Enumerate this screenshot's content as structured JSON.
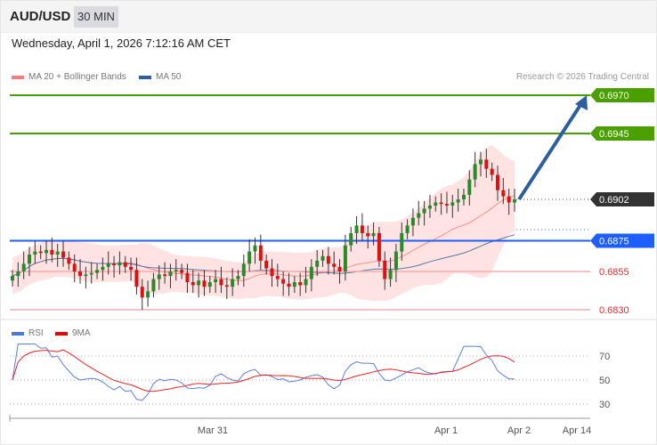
{
  "header": {
    "symbol": "AUD/USD",
    "timeframe": "30 MIN"
  },
  "timestamp": "Wednesday, April 1, 2026 7:12:16 AM CET",
  "legend": {
    "ma20": "MA 20 + Bollinger Bands",
    "ma50": "MA 50",
    "ma20_color": "#ff7b7b",
    "ma50_color": "#2d5fa0"
  },
  "copyright": "Research © 2026 Trading Central",
  "levels": [
    {
      "label": "0.6970",
      "value": 0.697,
      "type": "target",
      "color": "#4aa000"
    },
    {
      "label": "0.6945",
      "value": 0.6945,
      "type": "target",
      "color": "#4aa000"
    },
    {
      "label": "0.6902",
      "value": 0.6902,
      "type": "last",
      "color": "#333333"
    },
    {
      "label": "0.6875",
      "value": 0.6875,
      "type": "pivot",
      "color": "#1e5eff"
    },
    {
      "label": "0.6855",
      "value": 0.6855,
      "type": "support",
      "color": "#ff2020"
    },
    {
      "label": "0.6830",
      "value": 0.683,
      "type": "support",
      "color": "#ff2020"
    }
  ],
  "rsi_legend": {
    "rsi": "RSI",
    "ma": "9MA"
  },
  "rsi_ticks": [
    "70",
    "50",
    "30"
  ],
  "x_labels": [
    "Mar 31",
    "Apr 1",
    "Apr 2",
    "Apr 14"
  ],
  "chart_data": {
    "type": "candlestick",
    "ylim": [
      0.6822,
      0.6985
    ],
    "closes": [
      0.6852,
      0.6855,
      0.686,
      0.6866,
      0.6868,
      0.6867,
      0.6869,
      0.6866,
      0.6868,
      0.6864,
      0.686,
      0.6855,
      0.6852,
      0.6853,
      0.6854,
      0.6856,
      0.6858,
      0.686,
      0.6859,
      0.6861,
      0.6858,
      0.6856,
      0.6845,
      0.6838,
      0.6842,
      0.685,
      0.6853,
      0.6852,
      0.6855,
      0.6856,
      0.6854,
      0.6848,
      0.6846,
      0.6849,
      0.6845,
      0.6848,
      0.685,
      0.6846,
      0.6845,
      0.685,
      0.6852,
      0.686,
      0.6868,
      0.6872,
      0.6862,
      0.6857,
      0.6852,
      0.685,
      0.6847,
      0.6845,
      0.6848,
      0.6846,
      0.685,
      0.6858,
      0.6862,
      0.6865,
      0.686,
      0.6858,
      0.6855,
      0.6872,
      0.688,
      0.6885,
      0.688,
      0.6878,
      0.688,
      0.6862,
      0.685,
      0.6856,
      0.6868,
      0.688,
      0.6885,
      0.689,
      0.6893,
      0.6896,
      0.6898,
      0.69,
      0.6899,
      0.6898,
      0.69,
      0.6902,
      0.6905,
      0.6915,
      0.6925,
      0.6928,
      0.6922,
      0.6918,
      0.6908,
      0.6904,
      0.69,
      0.6902
    ],
    "forecast_target": 0.697
  }
}
